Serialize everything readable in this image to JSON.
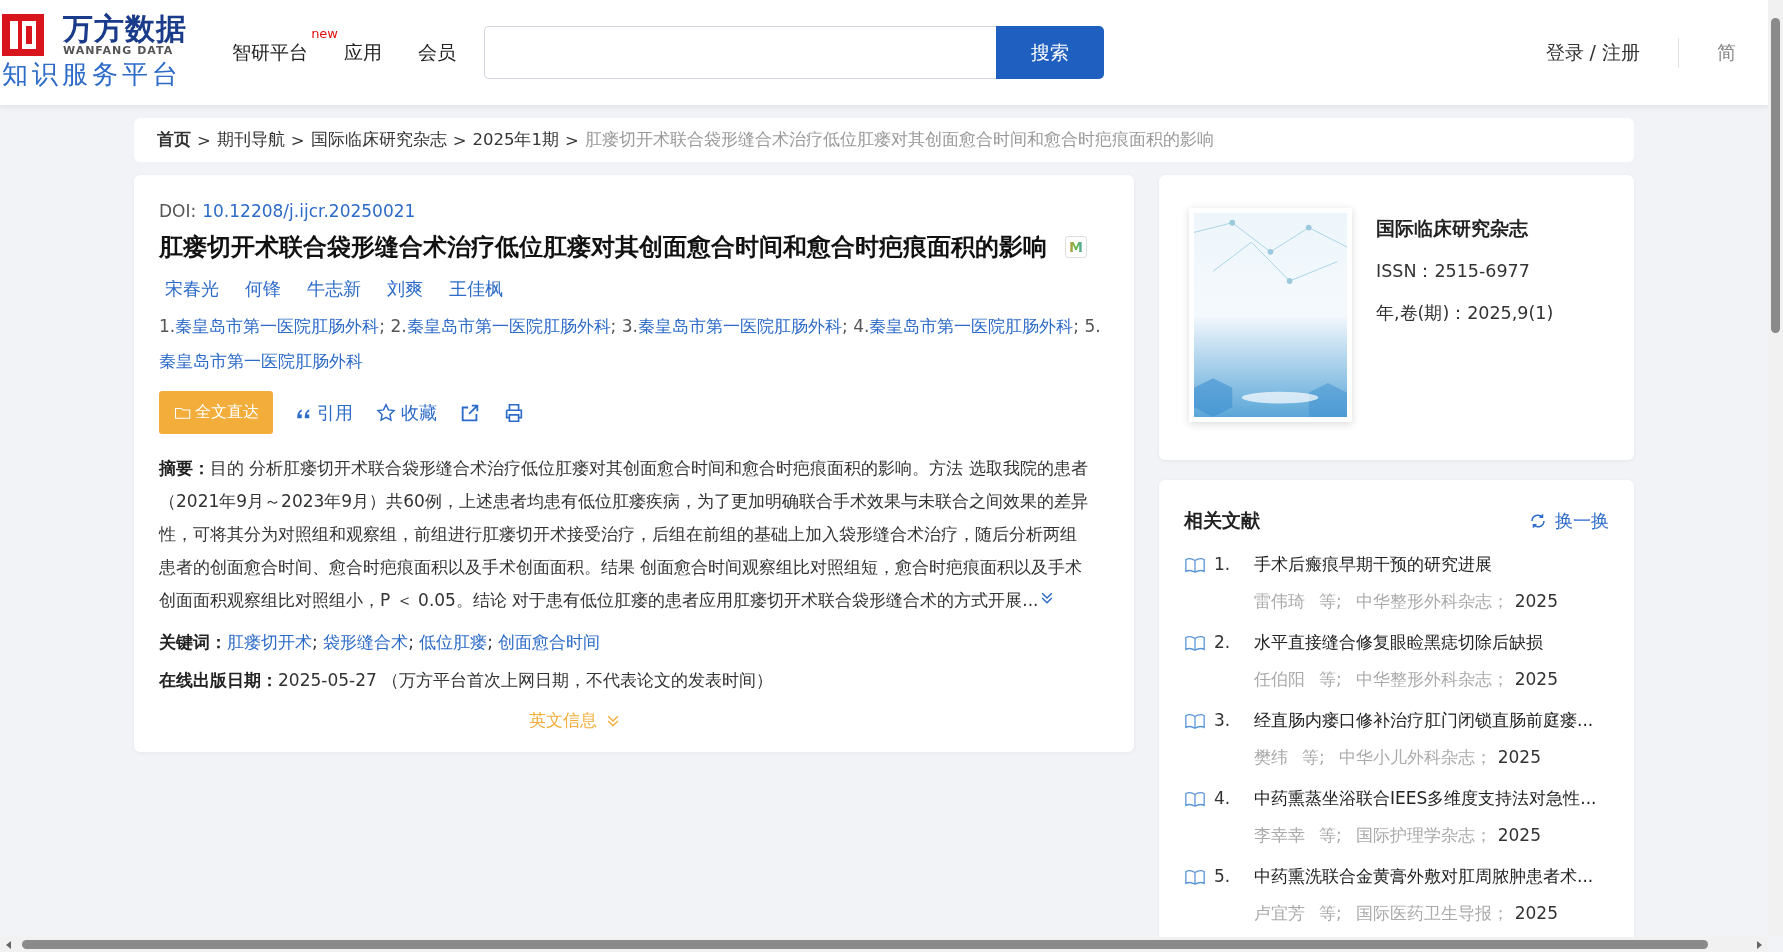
{
  "header": {
    "logo": {
      "brand": "万方数据",
      "latin": "WANFANG DATA",
      "tagline": "知识服务平台"
    },
    "nav": [
      {
        "label": "智研平台",
        "badge": "new"
      },
      {
        "label": "应用"
      },
      {
        "label": "会员"
      }
    ],
    "search": {
      "button": "搜索"
    },
    "login": "登录 / 注册",
    "language": "简"
  },
  "breadcrumb": [
    {
      "label": "首页",
      "kind": "home"
    },
    {
      "sep": ">",
      "label": "期刊导航",
      "kind": "link"
    },
    {
      "sep": ">",
      "label": "国际临床研究杂志",
      "kind": "link"
    },
    {
      "sep": ">",
      "label": "2025年1期",
      "kind": "link"
    },
    {
      "sep": ">",
      "label": "肛瘘切开术联合袋形缝合术治疗低位肛瘘对其创面愈合时间和愈合时疤痕面积的影响",
      "kind": "current"
    }
  ],
  "article": {
    "doi_label": "DOI:",
    "doi": "10.12208/j.ijcr.20250021",
    "title": "肛瘘切开术联合袋形缝合术治疗低位肛瘘对其创面愈合时间和愈合时疤痕面积的影响",
    "title_badge": "M",
    "authors": [
      "宋春光",
      "何锋",
      "牛志新",
      "刘爽",
      "王佳枫"
    ],
    "affiliations": [
      {
        "num": "1.",
        "name": "秦皇岛市第一医院肛肠外科",
        "sep": ";"
      },
      {
        "num": "2.",
        "name": "秦皇岛市第一医院肛肠外科",
        "sep": ";"
      },
      {
        "num": "3.",
        "name": "秦皇岛市第一医院肛肠外科",
        "sep": ";"
      },
      {
        "num": "4.",
        "name": "秦皇岛市第一医院肛肠外科",
        "sep": ";"
      },
      {
        "num": "5.",
        "name": "秦皇岛市第一医院肛肠外科"
      }
    ],
    "actions": [
      {
        "kind": "fulltext",
        "label": "全文直达"
      },
      {
        "kind": "cite",
        "label": "引用"
      },
      {
        "kind": "favorite",
        "label": "收藏"
      },
      {
        "kind": "share"
      },
      {
        "kind": "print"
      }
    ],
    "abstract": "**摘要：**目的 分析肛瘘切开术联合袋形缝合术治疗低位肛瘘对其创面愈合时间和愈合时疤痕面积的影响。方法 选取我院的患者（2021年9月～2023年9月）共60例，上述患者均患有低位肛瘘疾病，为了更加明确联合手术效果与未联合之间效果的差异性，可将其分为对照组和观察组，前组进行肛瘘切开术接受治疗，后组在前组的基础上加入袋形缝合术治疗，随后分析两组患者的创面愈合时间、愈合时疤痕面积以及手术创面面积。结果 创面愈合时间观察组比对照组短，愈合时疤痕面积以及手术创面面积观察组比对照组小，P ＜ 0.05。结论 对于患有低位肛瘘的患者应用肛瘘切开术联合袋形缝合术的方式开展...",
    "abstract_expanded": false,
    "keywords_label": "关键词：",
    "keywords": [
      {
        "label": "肛瘘切开术",
        "sep": ";"
      },
      {
        "label": "袋形缝合术",
        "sep": ";"
      },
      {
        "label": "低位肛瘘",
        "sep": ";"
      },
      {
        "label": "创面愈合时间"
      }
    ],
    "date_label": "在线出版日期：",
    "date": "2025-05-27 （万方平台首次上网日期，不代表论文的发表时间）",
    "english": {
      "label": "英文信息",
      "expanded": false
    }
  },
  "journal": {
    "name": "国际临床研究杂志",
    "issn": "ISSN：2515-6977",
    "volume": "年,卷(期)：2025,9(1)"
  },
  "related": {
    "title": "相关文献",
    "refresh": "换一换",
    "items": [
      {
        "num": "1.",
        "title": "手术后瘢痕早期干预的研究进展",
        "author": "雷伟琦",
        "etal": "等;",
        "journal": "中华整形外科杂志；",
        "year": "2025"
      },
      {
        "num": "2.",
        "title": "水平直接缝合修复眼睑黑痣切除后缺损",
        "author": "任伯阳",
        "etal": "等;",
        "journal": "中华整形外科杂志；",
        "year": "2025"
      },
      {
        "num": "3.",
        "title": "经直肠内瘘口修补治疗肛门闭锁直肠前庭瘘...",
        "author": "樊纬",
        "etal": "等;",
        "journal": "中华小儿外科杂志；",
        "year": "2025"
      },
      {
        "num": "4.",
        "title": "中药熏蒸坐浴联合IEES多维度支持法对急性...",
        "author": "李幸幸",
        "etal": "等;",
        "journal": "国际护理学杂志；",
        "year": "2025"
      },
      {
        "num": "5.",
        "title": "中药熏洗联合金黄膏外敷对肛周脓肿患者术...",
        "author": "卢宜芳",
        "etal": "等;",
        "journal": "国际医药卫生导报；",
        "year": "2025"
      }
    ]
  }
}
